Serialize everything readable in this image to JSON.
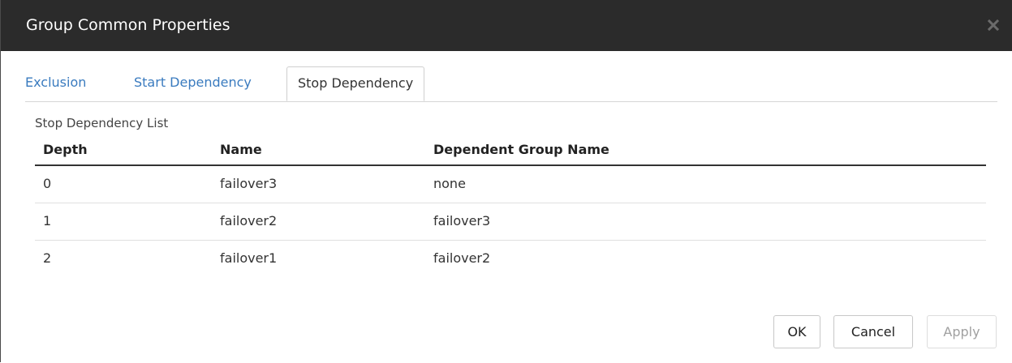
{
  "dialog": {
    "title": "Group Common Properties"
  },
  "tabs": [
    {
      "label": "Exclusion",
      "active": false
    },
    {
      "label": "Start Dependency",
      "active": false
    },
    {
      "label": "Stop Dependency",
      "active": true
    }
  ],
  "list": {
    "label": "Stop Dependency List",
    "columns": [
      "Depth",
      "Name",
      "Dependent Group Name"
    ],
    "rows": [
      {
        "depth": "0",
        "name": "failover3",
        "dependent": "none"
      },
      {
        "depth": "1",
        "name": "failover2",
        "dependent": "failover3"
      },
      {
        "depth": "2",
        "name": "failover1",
        "dependent": "failover2"
      }
    ]
  },
  "buttons": {
    "ok": "OK",
    "cancel": "Cancel",
    "apply": "Apply"
  },
  "colors": {
    "titlebar": "#2b2b2b",
    "tab_link": "#3a7bbf",
    "disabled_text": "#a0a0a0"
  },
  "icons": {
    "close": "close-icon"
  }
}
